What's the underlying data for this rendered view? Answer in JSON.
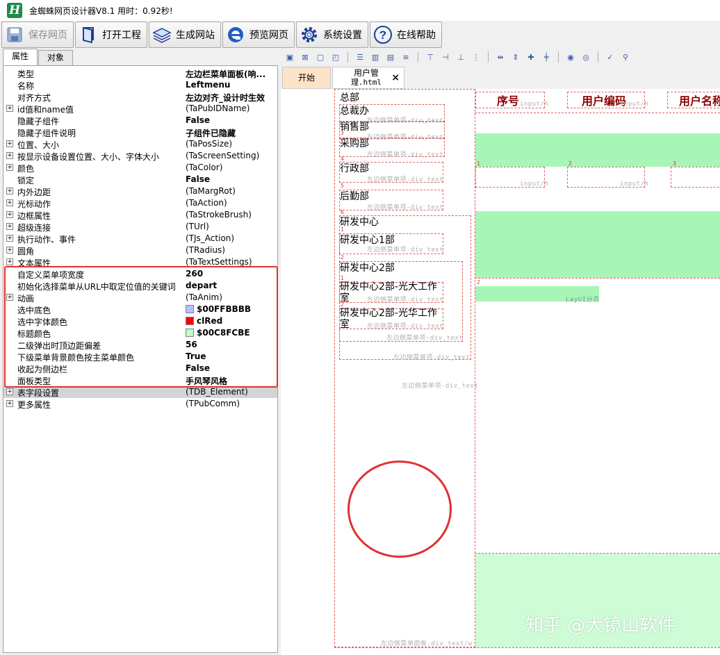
{
  "window": {
    "title": "金蜘蛛网页设计器V8.1 用时：0.92秒!"
  },
  "toolbar": [
    {
      "label": "保存网页",
      "icon": "save-icon",
      "disabled": true
    },
    {
      "label": "打开工程",
      "icon": "open-project-icon"
    },
    {
      "label": "生成网站",
      "icon": "layers-icon"
    },
    {
      "label": "预览网页",
      "icon": "ie-icon"
    },
    {
      "label": "系统设置",
      "icon": "gear-icon"
    },
    {
      "label": "在线帮助",
      "icon": "help-icon"
    }
  ],
  "left_tabs": [
    "属性",
    "对象"
  ],
  "properties": [
    {
      "name": "类型",
      "value": "左边栏菜单面板(响...",
      "bold": true
    },
    {
      "name": "名称",
      "value": "Leftmenu",
      "bold": true
    },
    {
      "name": "对齐方式",
      "value": "左边对齐_设计时生效",
      "bold": true
    },
    {
      "name": "id值和name值",
      "value": "(TaPubIDName)",
      "expand": true
    },
    {
      "name": "隐藏子组件",
      "value": "False",
      "bold": true
    },
    {
      "name": "隐藏子组件说明",
      "value": "子组件已隐藏",
      "bold": true
    },
    {
      "name": "位置、大小",
      "value": "(TaPosSize)",
      "expand": true
    },
    {
      "name": "按显示设备设置位置、大小、字体大小",
      "value": "(TaScreenSetting)",
      "expand": true
    },
    {
      "name": "颜色",
      "value": "(TaColor)",
      "expand": true
    },
    {
      "name": "锁定",
      "value": "False",
      "bold": true
    },
    {
      "name": "内外边距",
      "value": "(TaMargRot)",
      "expand": true
    },
    {
      "name": "光标动作",
      "value": "(TaAction)",
      "expand": true
    },
    {
      "name": "边框属性",
      "value": "(TaStrokeBrush)",
      "expand": true
    },
    {
      "name": "超级连接",
      "value": "(TUrl)",
      "expand": true
    },
    {
      "name": "执行动作、事件",
      "value": "(TJs_Action)",
      "expand": true
    },
    {
      "name": "圆角",
      "value": "(TRadius)",
      "expand": true
    },
    {
      "name": "文本属性",
      "value": "(TaTextSettings)",
      "expand": true
    },
    {
      "name": "自定义菜单项宽度",
      "value": "260",
      "bold": true
    },
    {
      "name": "初始化选择菜单从URL中取定位值的关键词",
      "value": "depart",
      "bold": true
    },
    {
      "name": "动画",
      "value": "(TaAnim)",
      "expand": true
    },
    {
      "name": "选中底色",
      "value": "$00FFBBBB",
      "bold": true,
      "swatch": "#bbbbff"
    },
    {
      "name": "选中字体颜色",
      "value": "clRed",
      "bold": true,
      "swatch": "#ff0000"
    },
    {
      "name": "标题颜色",
      "value": "$00C8FCBE",
      "bold": true,
      "swatch": "#befcc8"
    },
    {
      "name": "二级弹出时顶边距偏差",
      "value": "56",
      "bold": true
    },
    {
      "name": "下级菜单背景颜色按主菜单颜色",
      "value": "True",
      "bold": true
    },
    {
      "name": "收起为侧边栏",
      "value": "False",
      "bold": true
    },
    {
      "name": "面板类型",
      "value": "手风琴风格",
      "bold": true
    },
    {
      "name": "表字段设置",
      "value": "(TDB_Element)",
      "expand": true,
      "selected": true
    },
    {
      "name": "更多属性",
      "value": "(TPubComm)",
      "expand": true
    }
  ],
  "doc_tabs": {
    "start": "开始",
    "file_line1": "用户管",
    "file_line2": "理.html",
    "close": "×"
  },
  "canvas": {
    "menu_items": [
      {
        "text": "总部",
        "num": ""
      },
      {
        "text": "总裁办",
        "num": ""
      },
      {
        "text": "销售部",
        "num": ""
      },
      {
        "text": "采购部",
        "num": "3"
      },
      {
        "text": "行政部",
        "num": "4"
      },
      {
        "text": "后勤部",
        "num": "5"
      },
      {
        "text": "研发中心",
        "num": "6"
      },
      {
        "text": "研发中心1部",
        "num": "1"
      },
      {
        "text": "研发中心2部",
        "num": "2"
      },
      {
        "text": "研发中心2部-光大工作室",
        "num": "1"
      },
      {
        "text": "研发中心2部-光华工作室",
        "num": "2"
      }
    ],
    "item_label": "左边侧菜单项-div_text",
    "panel_label": "左边侧菜单面板-div_text/w",
    "headers": [
      "序号",
      "用户编码",
      "用户名称"
    ],
    "input_label": "input/h",
    "row_nums": [
      "1",
      "2",
      "3"
    ],
    "section_num": "2",
    "pager_label": "LayUI分页"
  },
  "watermark": "知乎 @大镜山软件"
}
